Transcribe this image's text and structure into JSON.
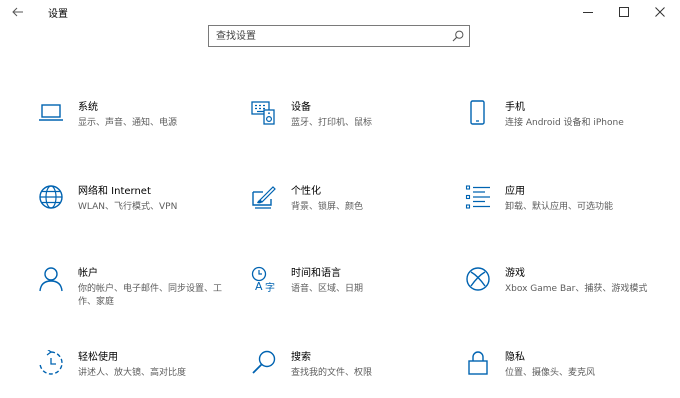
{
  "window": {
    "title": "设置"
  },
  "search": {
    "placeholder": "查找设置"
  },
  "tiles": [
    {
      "name": "系统",
      "desc": "显示、声音、通知、电源",
      "icon": "laptop-icon"
    },
    {
      "name": "设备",
      "desc": "蓝牙、打印机、鼠标",
      "icon": "keyboard-speaker-icon"
    },
    {
      "name": "手机",
      "desc": "连接 Android 设备和 iPhone",
      "icon": "phone-icon"
    },
    {
      "name": "网络和 Internet",
      "desc": "WLAN、飞行模式、VPN",
      "icon": "globe-icon"
    },
    {
      "name": "个性化",
      "desc": "背景、锁屏、颜色",
      "icon": "paint-brush-icon"
    },
    {
      "name": "应用",
      "desc": "卸载、默认应用、可选功能",
      "icon": "apps-list-icon"
    },
    {
      "name": "帐户",
      "desc": "你的帐户、电子邮件、同步设置、工作、家庭",
      "icon": "person-icon"
    },
    {
      "name": "时间和语言",
      "desc": "语音、区域、日期",
      "icon": "time-language-icon"
    },
    {
      "name": "游戏",
      "desc": "Xbox Game Bar、捕获、游戏模式",
      "icon": "xbox-icon"
    },
    {
      "name": "轻松使用",
      "desc": "讲述人、放大镜、高对比度",
      "icon": "ease-of-access-icon"
    },
    {
      "name": "搜索",
      "desc": "查找我的文件、权限",
      "icon": "search-icon"
    },
    {
      "name": "隐私",
      "desc": "位置、摄像头、麦克风",
      "icon": "lock-icon"
    }
  ],
  "colors": {
    "accent": "#0063b1",
    "text": "#000000",
    "secondary_text": "#5c5c5c"
  }
}
